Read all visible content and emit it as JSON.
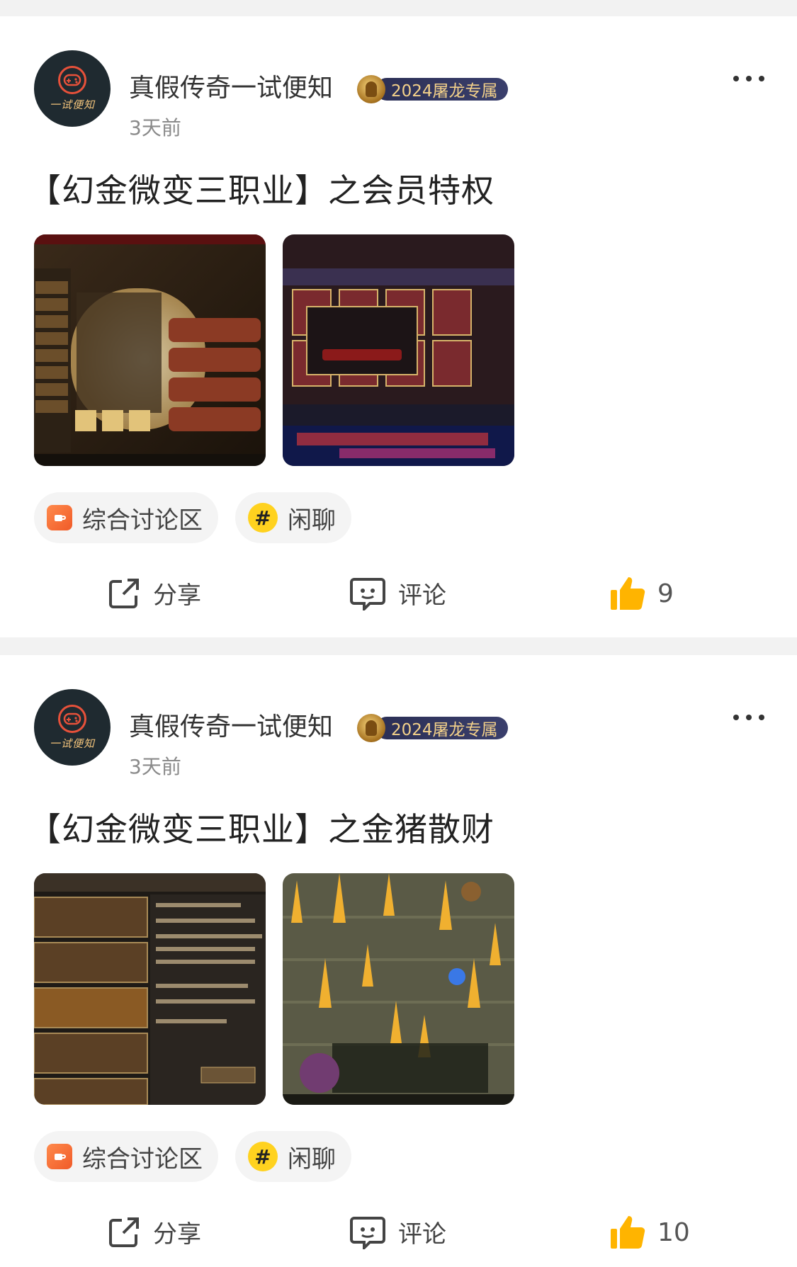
{
  "posts": [
    {
      "author": "真假传奇一试便知",
      "avatar_text": "一试便知",
      "badge": "2024屠龙专属",
      "time": "3天前",
      "title": "【幻金微变三职业】之会员特权",
      "tags": [
        {
          "label": "综合讨论区",
          "icon": "coffee-cup-icon"
        },
        {
          "label": "闲聊",
          "icon": "hashtag-icon"
        }
      ],
      "share_label": "分享",
      "comment_label": "评论",
      "like_count": "9"
    },
    {
      "author": "真假传奇一试便知",
      "avatar_text": "一试便知",
      "badge": "2024屠龙专属",
      "time": "3天前",
      "title": "【幻金微变三职业】之金猪散财",
      "tags": [
        {
          "label": "综合讨论区",
          "icon": "coffee-cup-icon"
        },
        {
          "label": "闲聊",
          "icon": "hashtag-icon"
        }
      ],
      "share_label": "分享",
      "comment_label": "评论",
      "like_count": "10"
    }
  ],
  "colors": {
    "separator": "#f2f2f2",
    "badge_bg": "#2b2f55",
    "badge_text": "#f3d18a",
    "like_icon": "#ffb400",
    "tag_bg": "#f4f4f4"
  }
}
